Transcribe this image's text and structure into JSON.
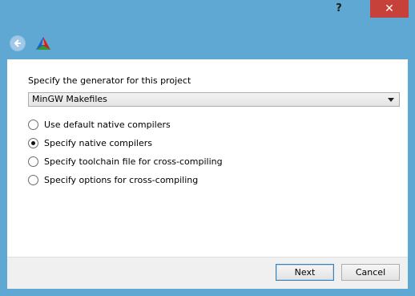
{
  "titlebar": {
    "help_label": "?",
    "close_label": "✕"
  },
  "nav": {
    "back_icon": "back-arrow-icon",
    "app_icon": "cmake-logo-icon"
  },
  "generator": {
    "prompt": "Specify the generator for this project",
    "selected": "MinGW Makefiles"
  },
  "options": [
    {
      "label": "Use default native compilers",
      "checked": false
    },
    {
      "label": "Specify native compilers",
      "checked": true
    },
    {
      "label": "Specify toolchain file for cross-compiling",
      "checked": false
    },
    {
      "label": "Specify options for cross-compiling",
      "checked": false
    }
  ],
  "footer": {
    "next_label": "Next",
    "cancel_label": "Cancel"
  },
  "colors": {
    "frame": "#5fa8d3",
    "close": "#c6413a"
  }
}
